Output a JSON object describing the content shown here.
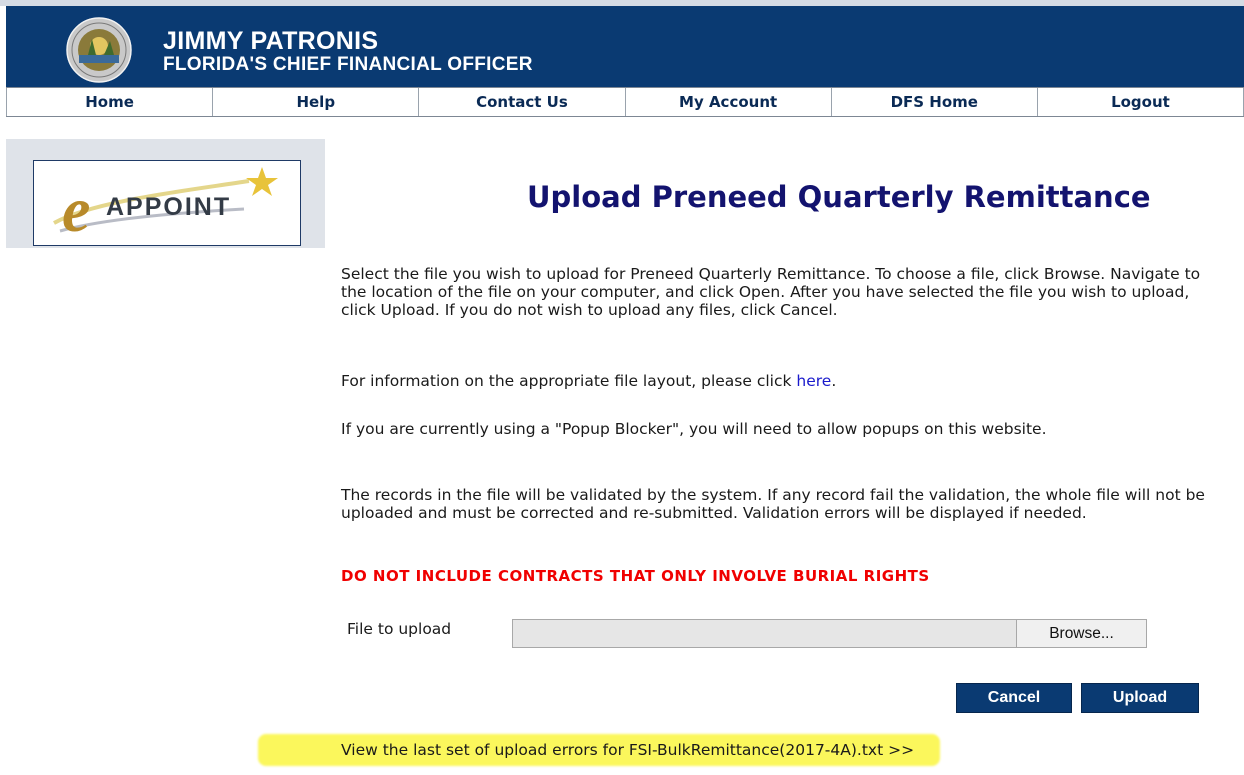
{
  "header": {
    "name": "JIMMY PATRONIS",
    "subtitle": "FLORIDA'S CHIEF FINANCIAL OFFICER",
    "seal_icon": "florida-cfo-seal-icon",
    "background_color": "#0a3a72"
  },
  "nav": {
    "items": [
      {
        "label": "Home"
      },
      {
        "label": "Help"
      },
      {
        "label": "Contact Us"
      },
      {
        "label": "My Account"
      },
      {
        "label": "DFS Home"
      },
      {
        "label": "Logout"
      }
    ]
  },
  "sidebar": {
    "logo_e": "e",
    "logo_text": "APPOINT",
    "logo_icon": "eappoint-star-logo-icon"
  },
  "main": {
    "title": "Upload Preneed Quarterly Remittance",
    "paragraph1": "Select the file you wish to upload for Preneed Quarterly Remittance. To choose a file, click Browse. Navigate to the location of the file on your computer, and click Open. After you have selected the file you wish to upload, click Upload. If you do not wish to upload any files, click Cancel.",
    "paragraph2_prefix": "For information on the appropriate file layout, please click ",
    "paragraph2_link": "here",
    "paragraph2_suffix": ".",
    "paragraph3": "If you are currently using a \"Popup Blocker\", you will need to allow popups on this website.",
    "paragraph4": "The records in the file will be validated by the system. If any record fail the validation, the whole file will not be uploaded and must be corrected and re-submitted. Validation errors will be displayed if needed.",
    "warning": "DO NOT INCLUDE CONTRACTS THAT ONLY INVOLVE BURIAL RIGHTS",
    "warning_color": "#f00000"
  },
  "upload": {
    "file_label": "File to upload",
    "file_value": "",
    "browse_label": "Browse..."
  },
  "actions": {
    "cancel_label": "Cancel",
    "upload_label": "Upload"
  },
  "errors_link": {
    "label": "View the last set of upload errors for FSI-BulkRemittance(2017-4A).txt >>",
    "highlight_color": "#fbf75c"
  }
}
